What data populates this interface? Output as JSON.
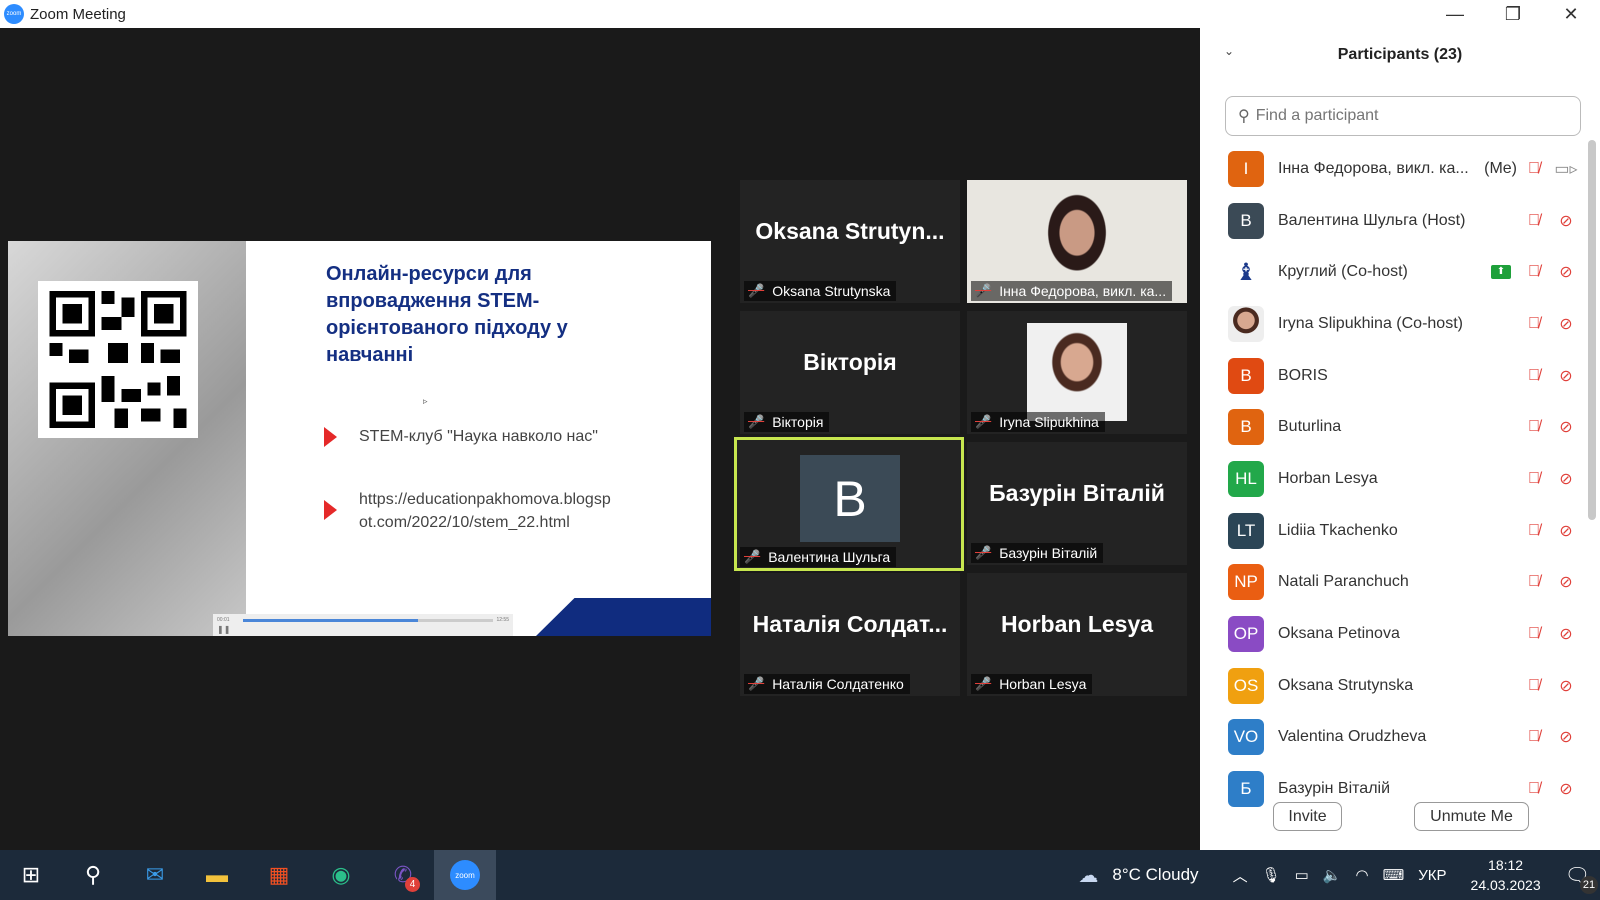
{
  "window": {
    "title": "Zoom Meeting",
    "minimize": "—",
    "restore": "❐",
    "close": "✕",
    "logo": "zoom"
  },
  "slide": {
    "title": "Онлайн-ресурси для впровадження STEM-орієнтованого підходу у навчанні",
    "bullets": [
      "STEM-клуб \"Наука навколо нас\"",
      "https://educationpakhomova.blogspot.com/2022/10/stem_22.html"
    ],
    "player_progress": 0.7,
    "player_time_start": "00:01",
    "player_time_end": "12:55"
  },
  "tiles": [
    {
      "big": "Oksana  Strutyn...",
      "label": "Oksana Strutynska"
    },
    {
      "big": "",
      "label": "Інна Федорова, викл. ка..."
    },
    {
      "big": "Вікторія",
      "label": "Вікторія"
    },
    {
      "big": "",
      "label": "Iryna Slipukhina"
    },
    {
      "big": "B",
      "label": "Валентина Шульга"
    },
    {
      "big": "Базурін Віталій",
      "label": "Базурін Віталій"
    },
    {
      "big": "Наталія  Солдат...",
      "label": "Наталія Солдатенко"
    },
    {
      "big": "Horban Lesya",
      "label": "Horban Lesya"
    }
  ],
  "participants": {
    "title": "Participants (23)",
    "search_placeholder": "Find a participant",
    "items": [
      {
        "initials": "I",
        "name": "Інна Федорова, викл. ка...",
        "tag": "(Me)",
        "color": "#e06410",
        "camera_on": true
      },
      {
        "initials": "B",
        "name": "Валентина Шульга (Host)",
        "tag": "",
        "color": "#3b4a56"
      },
      {
        "initials": "",
        "name": "Круглий (Co-host)",
        "tag": "",
        "color": "#ffffff",
        "sharing": true
      },
      {
        "initials": "",
        "name": "Iryna Slipukhina (Co-host)",
        "tag": "",
        "color": "#bbbbbb"
      },
      {
        "initials": "B",
        "name": "BORIS",
        "tag": "",
        "color": "#e04a12"
      },
      {
        "initials": "B",
        "name": "Buturlina",
        "tag": "",
        "color": "#e06410"
      },
      {
        "initials": "HL",
        "name": "Horban Lesya",
        "tag": "",
        "color": "#22a84a"
      },
      {
        "initials": "LT",
        "name": "Lidiia Tkachenko",
        "tag": "",
        "color": "#2b4556"
      },
      {
        "initials": "NP",
        "name": "Natali Paranchuch",
        "tag": "",
        "color": "#ea5e12"
      },
      {
        "initials": "OP",
        "name": "Oksana Petinova",
        "tag": "",
        "color": "#8a4bc4"
      },
      {
        "initials": "OS",
        "name": "Oksana Strutynska",
        "tag": "",
        "color": "#f0a010"
      },
      {
        "initials": "VO",
        "name": "Valentina Orudzheva",
        "tag": "",
        "color": "#2e7ec8"
      },
      {
        "initials": "Б",
        "name": "Базурін Віталій",
        "tag": "",
        "color": "#2e7ec8"
      }
    ],
    "invite": "Invite",
    "unmute": "Unmute Me"
  },
  "taskbar": {
    "weather": "8°C  Cloudy",
    "lang": "УКР",
    "time": "18:12",
    "date": "24.03.2023",
    "notifications": "21",
    "viber_badge": "4"
  }
}
